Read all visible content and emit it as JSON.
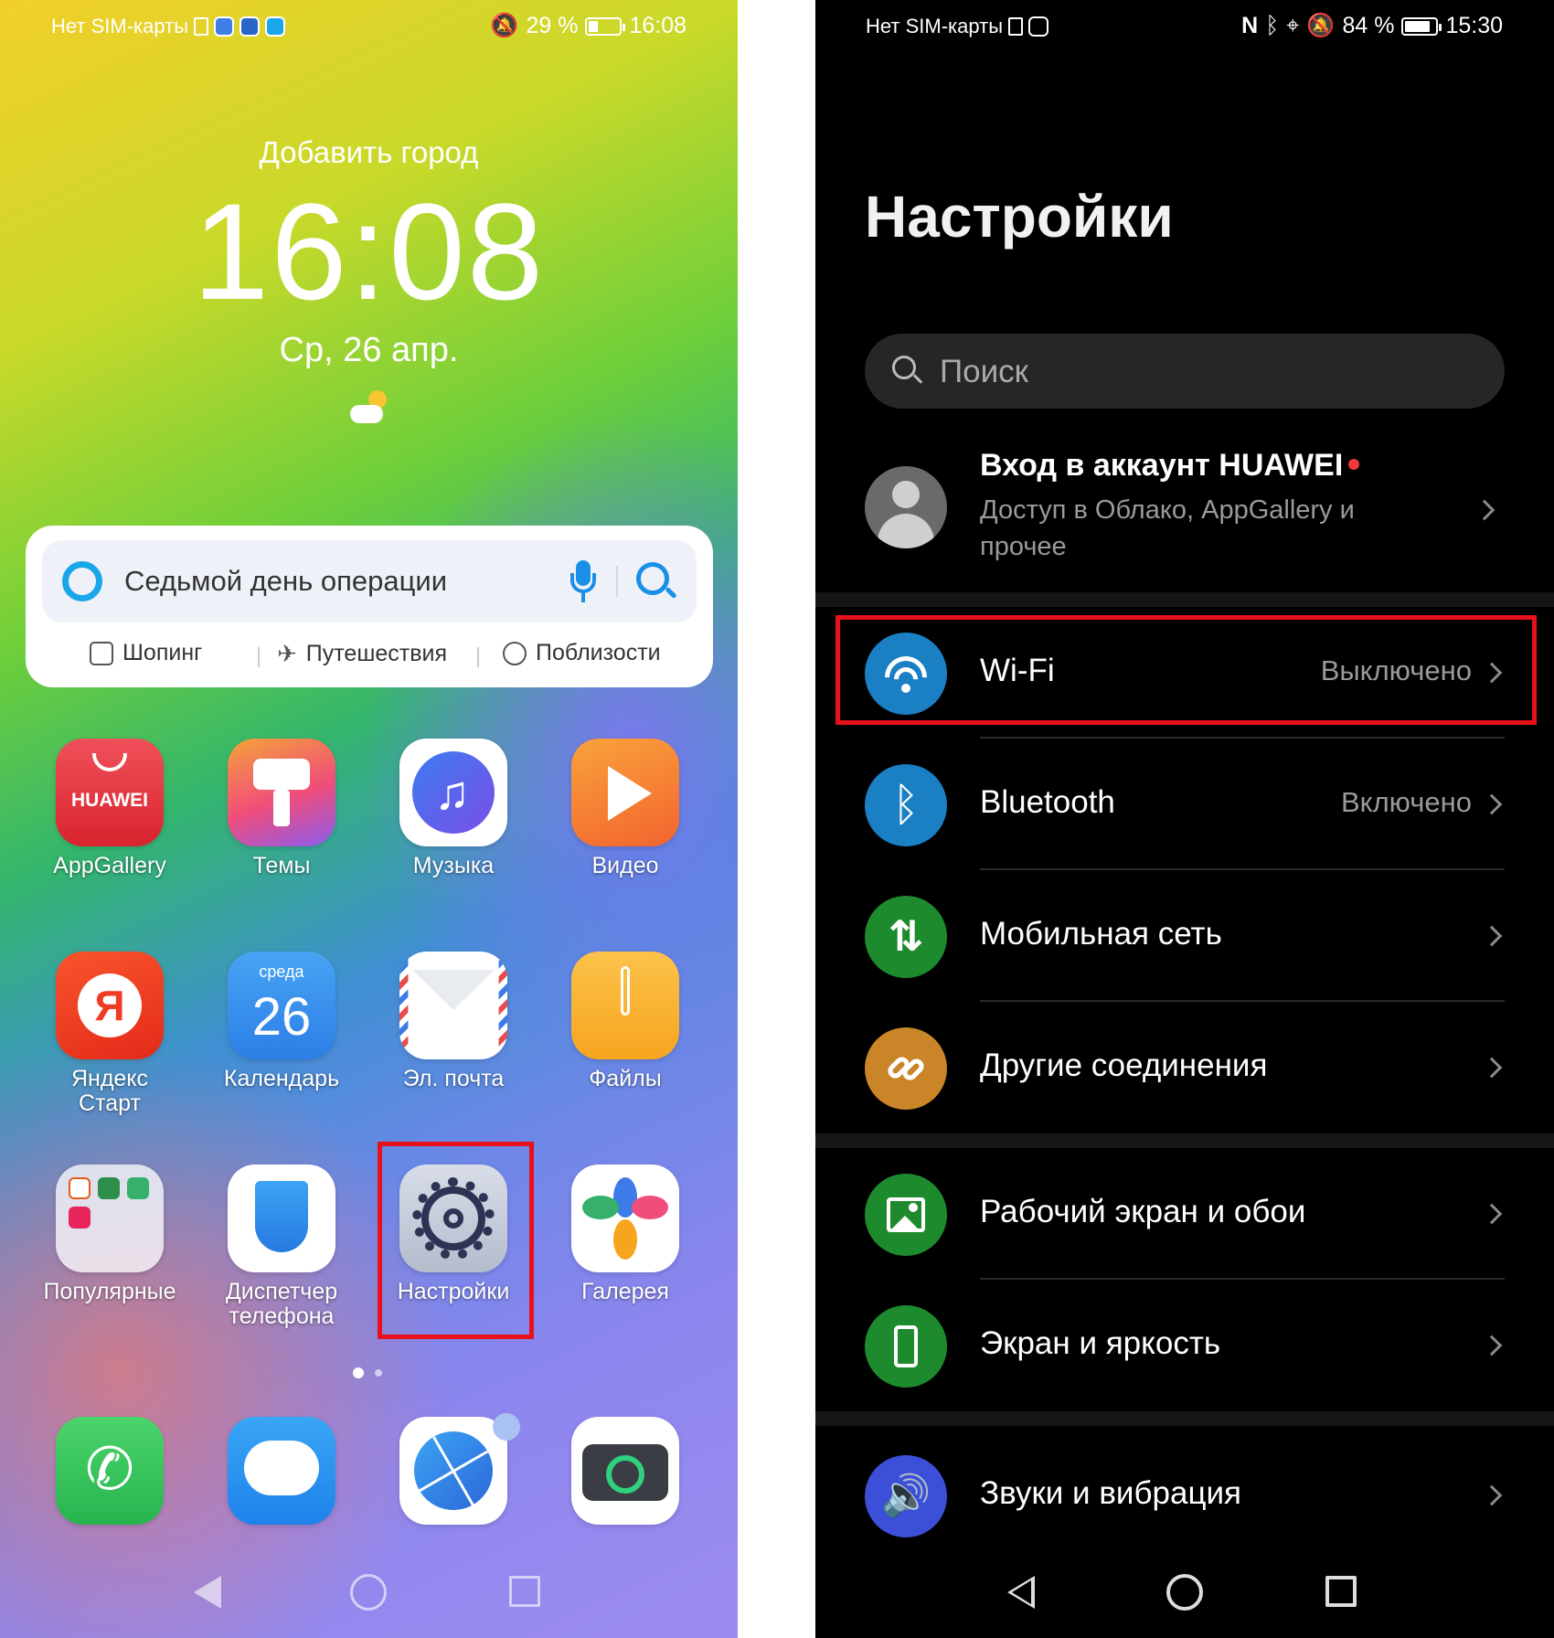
{
  "home": {
    "status": {
      "carrier": "Нет SIM-карты",
      "battery": "29 %",
      "battery_level": 0.29,
      "time": "16:08"
    },
    "widget": {
      "city": "Добавить город",
      "time": "16:08",
      "date": "Ср, 26 апр."
    },
    "search": {
      "text": "Седьмой день операции",
      "quick_links": [
        "Шопинг",
        "Путешествия",
        "Поблизости"
      ]
    },
    "apps": [
      {
        "label": "AppGallery",
        "icon": "appgallery-icon",
        "badge": "HUAWEI"
      },
      {
        "label": "Темы",
        "icon": "themes-icon"
      },
      {
        "label": "Музыка",
        "icon": "music-icon"
      },
      {
        "label": "Видео",
        "icon": "video-icon"
      },
      {
        "label": "Яндекс Старт",
        "icon": "yandex-icon",
        "badge": "Я"
      },
      {
        "label": "Календарь",
        "icon": "calendar-icon",
        "day_name": "среда",
        "day": "26"
      },
      {
        "label": "Эл. почта",
        "icon": "mail-icon"
      },
      {
        "label": "Файлы",
        "icon": "files-icon"
      },
      {
        "label": "Популярные",
        "icon": "folder-icon"
      },
      {
        "label": "Диспетчер телефона",
        "icon": "shield-icon"
      },
      {
        "label": "Настройки",
        "icon": "settings-gear-icon"
      },
      {
        "label": "Галерея",
        "icon": "gallery-icon"
      }
    ],
    "dock": [
      "phone-icon",
      "messages-icon",
      "browser-icon",
      "camera-icon"
    ]
  },
  "settings": {
    "status": {
      "carrier": "Нет SIM-карты",
      "battery": "84 %",
      "battery_level": 0.84,
      "time": "15:30"
    },
    "title": "Настройки",
    "search_placeholder": "Поиск",
    "account": {
      "title": "Вход в аккаунт HUAWEI",
      "subtitle": "Доступ в Облако, AppGallery и прочее"
    },
    "items": [
      {
        "label": "Wi-Fi",
        "value": "Выключено",
        "icon": "wifi-icon",
        "color": "#1a7fc3"
      },
      {
        "label": "Bluetooth",
        "value": "Включено",
        "icon": "bluetooth-icon",
        "color": "#1a7fc3"
      },
      {
        "label": "Мобильная сеть",
        "value": "",
        "icon": "mobile-network-icon",
        "color": "#1e8a2e"
      },
      {
        "label": "Другие соединения",
        "value": "",
        "icon": "link-icon",
        "color": "#c98528"
      },
      {
        "label": "Рабочий экран и обои",
        "value": "",
        "icon": "wallpaper-icon",
        "color": "#1e8a2e"
      },
      {
        "label": "Экран и яркость",
        "value": "",
        "icon": "display-icon",
        "color": "#1e8a2e"
      },
      {
        "label": "Звуки и вибрация",
        "value": "",
        "icon": "sound-icon",
        "color": "#3c4fd8"
      }
    ]
  },
  "colors": {
    "highlight": "#e8101a"
  }
}
